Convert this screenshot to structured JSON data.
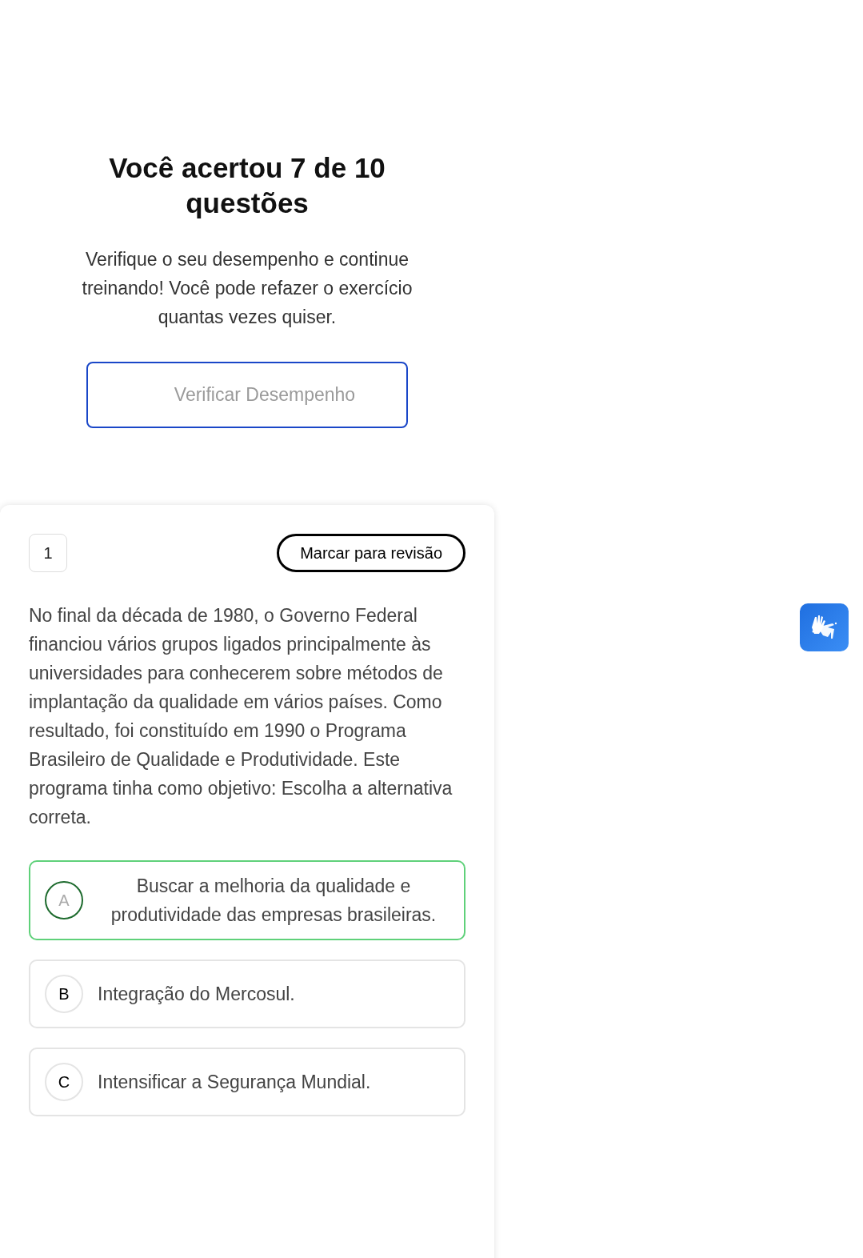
{
  "result": {
    "title": "Você acertou 7 de 10 questões",
    "message": "Verifique o seu desempenho e continue treinando! Você pode refazer o exercício quantas vezes quiser.",
    "button": "Verificar Desempenho"
  },
  "question": {
    "number": "1",
    "review_button": "Marcar para revisão",
    "text": "No final da década de 1980, o Governo Federal financiou vários grupos ligados principalmente às universidades para conhecerem sobre métodos de implantação da qualidade em vários países. Como resultado, foi constituído em 1990 o Programa Brasileiro de Qualidade e Produtividade. Este programa tinha como objetivo: Escolha a alternativa correta.",
    "options": [
      {
        "letter": "A",
        "text": "Buscar a melhoria da qualidade e produtividade das empresas brasileiras.",
        "correct": true
      },
      {
        "letter": "B",
        "text": "Integração do Mercosul.",
        "correct": false
      },
      {
        "letter": "C",
        "text": "Intensificar a Segurança Mundial.",
        "correct": false
      }
    ]
  }
}
